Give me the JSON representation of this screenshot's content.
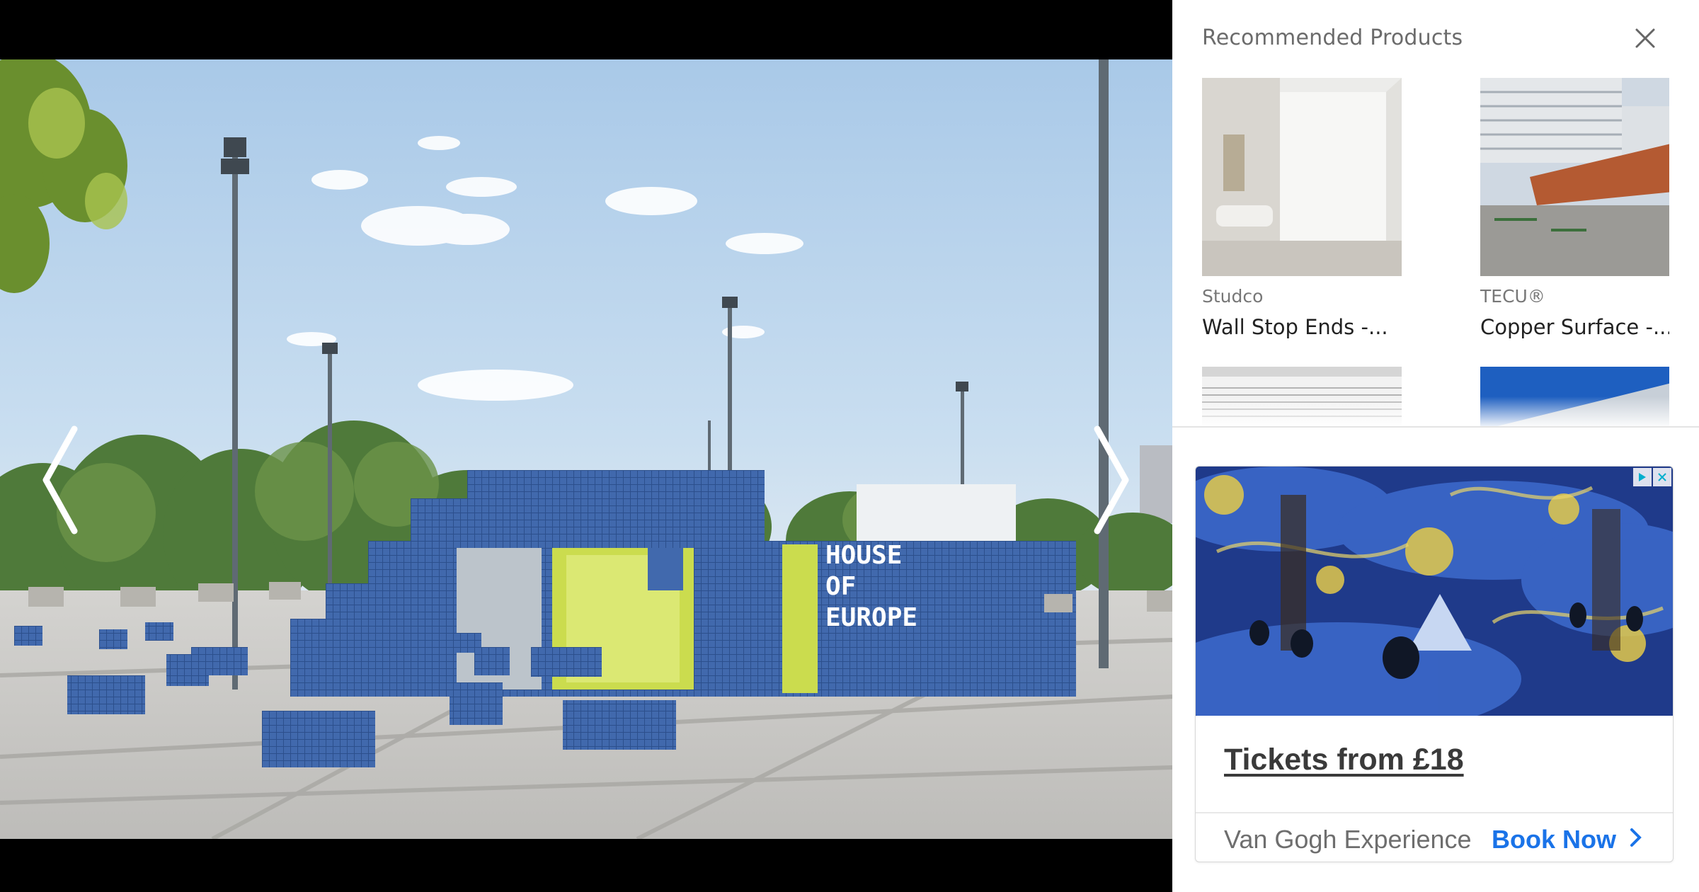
{
  "viewer": {
    "photo_subject": "House of Europe pavilion",
    "sign_text": [
      "HOUSE",
      "OF",
      "EUROPE"
    ],
    "prev_icon": "chevron-left-icon",
    "next_icon": "chevron-right-icon"
  },
  "sidebar": {
    "title": "Recommended Products",
    "close_icon": "close-icon",
    "products": [
      {
        "brand": "Studco",
        "name": "Wall Stop Ends -..."
      },
      {
        "brand": "TECU®",
        "name": "Copper Surface -..."
      },
      {
        "brand": "",
        "name": ""
      },
      {
        "brand": "",
        "name": ""
      }
    ]
  },
  "ad": {
    "headline": "Tickets from £18",
    "advertiser": "Van Gogh Experience",
    "cta": "Book Now",
    "badges": [
      "adchoices-icon",
      "close-icon"
    ],
    "colors": {
      "cta": "#1a73e8",
      "headline": "#3a3a3a"
    }
  }
}
